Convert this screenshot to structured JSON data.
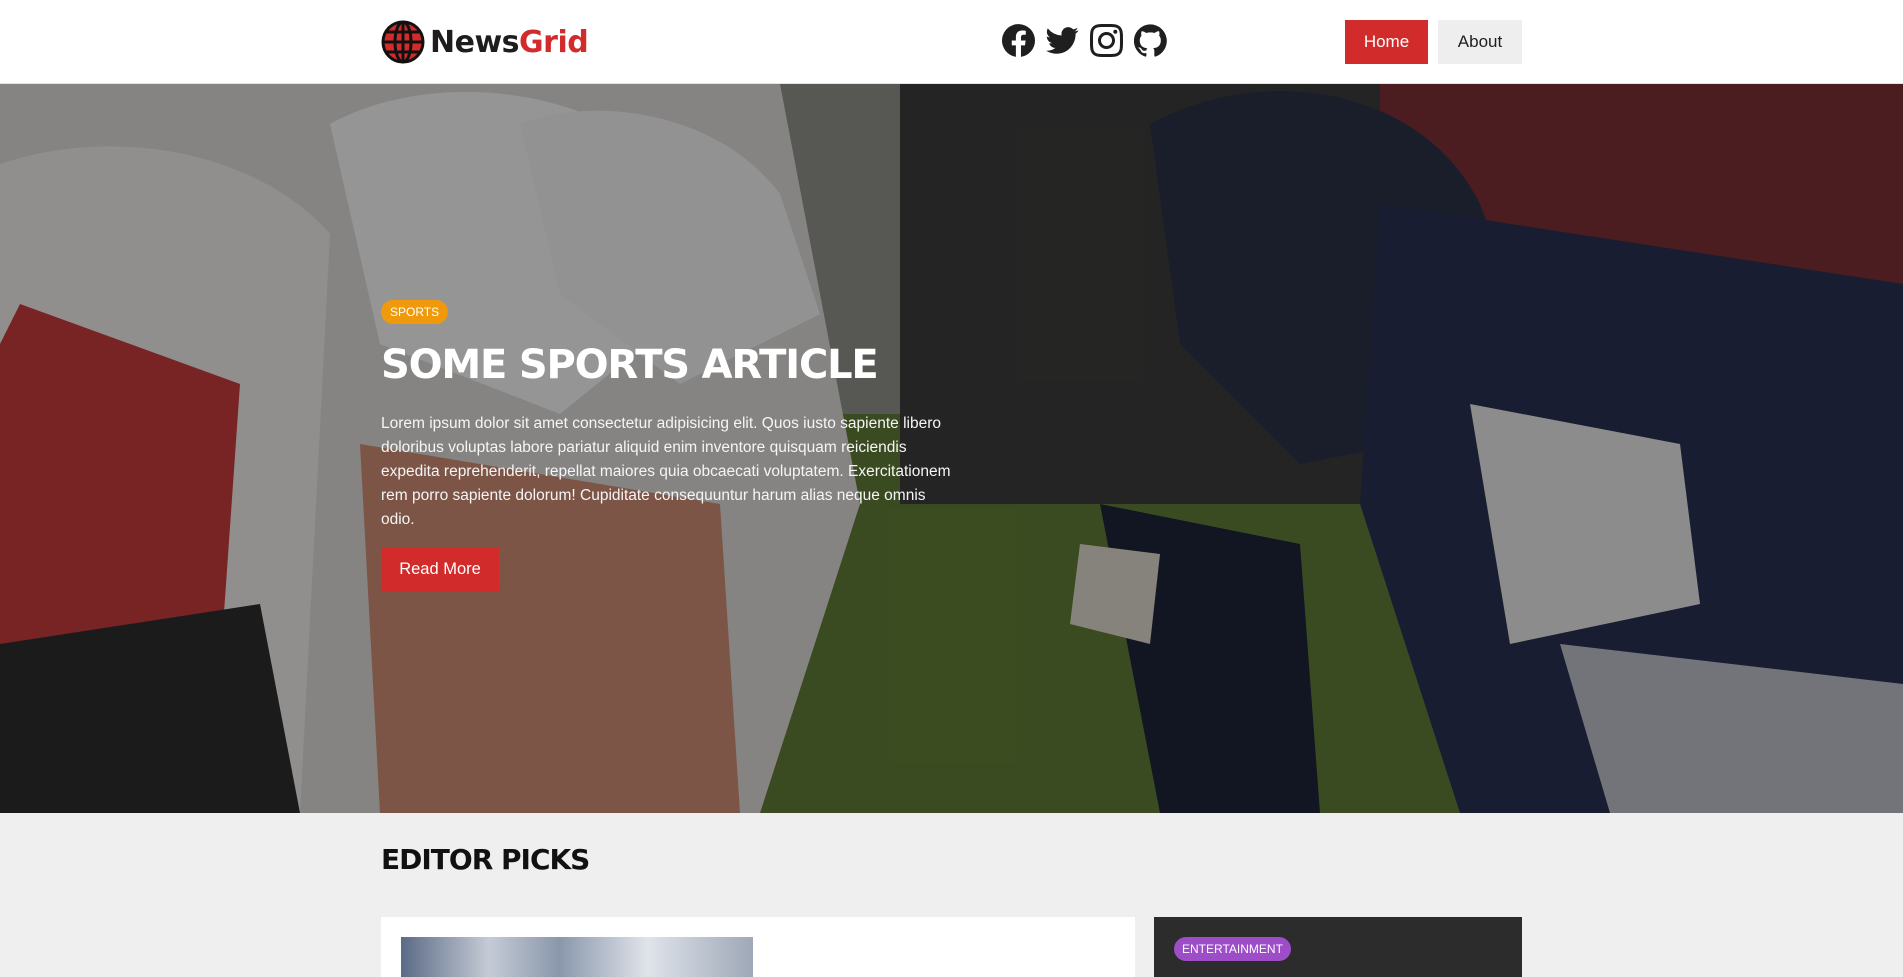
{
  "header": {
    "logo_part1": "News",
    "logo_part2": "Grid",
    "socials": [
      "facebook-icon",
      "twitter-icon",
      "instagram-icon",
      "github-icon"
    ],
    "nav": {
      "home": "Home",
      "about": "About"
    }
  },
  "hero": {
    "category": "SPORTS",
    "title": "Some Sports Article",
    "text": "Lorem ipsum dolor sit amet consectetur adipisicing elit. Quos iusto sapiente libero doloribus voluptas labore pariatur aliquid enim inventore quisquam reiciendis expedita reprehenderit, repellat maiores quia obcaecati voluptatem. Exercitationem rem porro sapiente dolorum! Cupiditate consequuntur harum alias neque omnis odio.",
    "button": "Read More"
  },
  "picks": {
    "title": "Editor Picks",
    "side_category": "ENTERTAINMENT"
  },
  "colors": {
    "accent": "#d12b2b",
    "sports_badge": "#f09a0b",
    "entertainment_badge": "#9c4dc7"
  }
}
